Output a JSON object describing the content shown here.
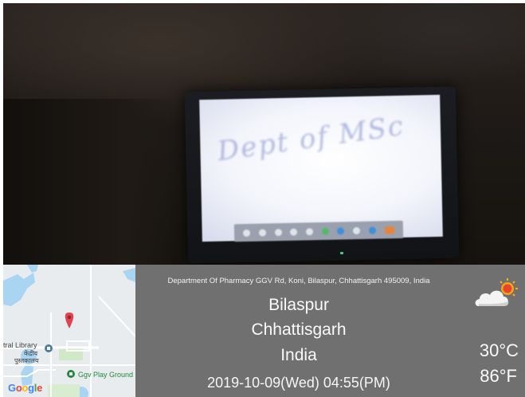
{
  "photo": {
    "scene": "board",
    "board_scribble": "Dept of MSc"
  },
  "map": {
    "labels": {
      "library_en": "tral Library",
      "library_hi": "केंद्रीय",
      "library_hi2": "पुस्तकालय",
      "play_ground": "Ggv Play Ground"
    },
    "logo": "Google",
    "colors": {
      "water": "#a9d4f2",
      "road": "#ffffff",
      "land": "#e9ecef",
      "pin": "#e0434f",
      "green": "#cfe8c5"
    }
  },
  "location": {
    "address": "Department Of Pharmacy GGV Rd, Koni, Bilaspur, Chhattisgarh 495009, India",
    "city": "Bilaspur",
    "state": "Chhattisgarh",
    "country": "India",
    "datetime": "2019-10-09(Wed)   04:55(PM)"
  },
  "weather": {
    "icon": "partly-cloudy-sun-icon",
    "temp_c": "30°C",
    "temp_f": "86°F"
  },
  "colors": {
    "panel": "#707070",
    "text": "#ffffff"
  }
}
